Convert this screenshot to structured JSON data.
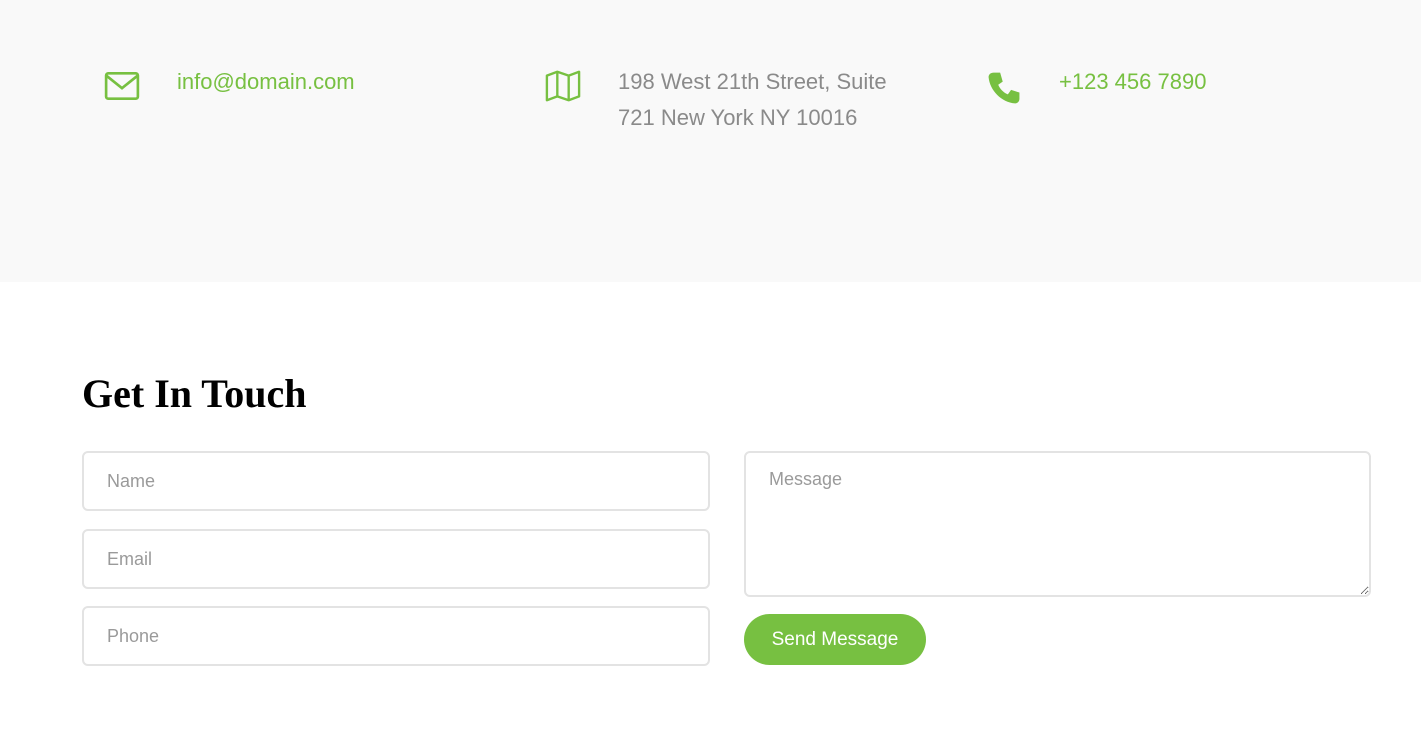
{
  "contact": {
    "email": "info@domain.com",
    "address_line1": "198 West 21th Street, Suite",
    "address_line2": "721 New York NY 10016",
    "phone": "+123 456 7890",
    "icons": {
      "email": "envelope-icon",
      "address": "map-icon",
      "phone": "phone-icon"
    }
  },
  "form": {
    "heading": "Get In Touch",
    "name_placeholder": "Name",
    "email_placeholder": "Email",
    "phone_placeholder": "Phone",
    "message_placeholder": "Message",
    "submit_label": "Send Message"
  },
  "colors": {
    "accent": "#77c041",
    "band_background": "#f9f9f9",
    "muted_text": "#8a8a8a",
    "field_border": "#e3e3e3"
  }
}
